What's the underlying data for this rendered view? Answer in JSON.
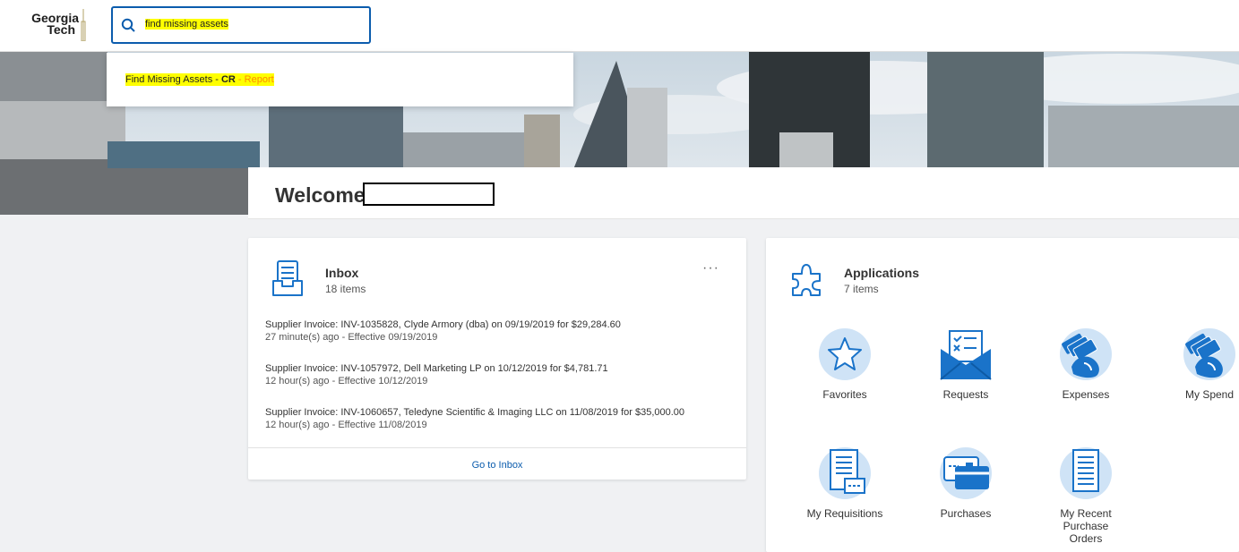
{
  "header": {
    "logo_line1": "Georgia",
    "logo_line2": "Tech",
    "search_value": "find missing assets"
  },
  "search_results": {
    "item_prefix": "Find Missing Assets - ",
    "item_bold": "CR",
    "item_suffix": " - Report"
  },
  "welcome": {
    "text": "Welcome,"
  },
  "inbox": {
    "title": "Inbox",
    "count": "18 items",
    "more": "···",
    "tasks": [
      {
        "title": "Supplier Invoice: INV-1035828, Clyde Armory (dba) on 09/19/2019 for $29,284.60",
        "meta": "27 minute(s) ago - Effective 09/19/2019"
      },
      {
        "title": "Supplier Invoice: INV-1057972, Dell Marketing LP on 10/12/2019 for $4,781.71",
        "meta": "12 hour(s) ago - Effective 10/12/2019"
      },
      {
        "title": "Supplier Invoice: INV-1060657, Teledyne Scientific & Imaging LLC on 11/08/2019 for $35,000.00",
        "meta": "12 hour(s) ago - Effective 11/08/2019"
      }
    ],
    "go_label": "Go to Inbox"
  },
  "applications": {
    "title": "Applications",
    "count": "7 items",
    "items": [
      {
        "label": "Favorites",
        "icon": "star-icon"
      },
      {
        "label": "Requests",
        "icon": "envelope-checklist-icon"
      },
      {
        "label": "Expenses",
        "icon": "hand-cash-icon"
      },
      {
        "label": "My Spend",
        "icon": "hand-cash-icon"
      },
      {
        "label": "My Requisitions",
        "icon": "document-form-icon"
      },
      {
        "label": "Purchases",
        "icon": "credit-card-icon"
      },
      {
        "label": "My Recent Purchase Orders",
        "icon": "document-list-icon"
      }
    ]
  },
  "colors": {
    "accent": "#0b5cad",
    "highlight": "#ffff00",
    "icon_blue": "#1a73c9",
    "icon_bg": "#cfe3f6"
  }
}
